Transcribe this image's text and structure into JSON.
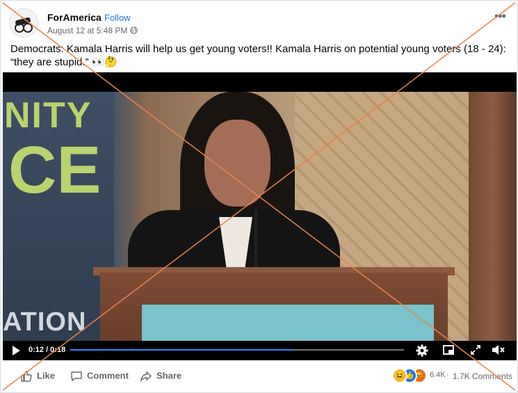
{
  "post": {
    "page_name": "ForAmerica",
    "separator": "·",
    "follow_label": "Follow",
    "timestamp": "August 12 at 5:48 PM ·",
    "more_label": "•••",
    "text": "Democrats: Kamala Harris will help us get young voters!! Kamala Harris on potential young voters (18 - 24): “they are stupid.” 👀🤔"
  },
  "video": {
    "banner_line1": "NITY",
    "banner_line2": "CE",
    "banner_line3": "ATION",
    "time_display": "0:12 / 0:18",
    "progress_fraction": 0.667
  },
  "actions": {
    "like_label": "Like",
    "comment_label": "Comment",
    "share_label": "Share"
  },
  "reactions": {
    "count": "6.4K",
    "dot": "·",
    "comments": "1.7K Comments",
    "icons": [
      "haha-icon",
      "like-icon",
      "angry-icon"
    ]
  },
  "colors": {
    "link": "#216fdb",
    "progress": "#2d88ff",
    "overlay_x": "#e8834f"
  }
}
